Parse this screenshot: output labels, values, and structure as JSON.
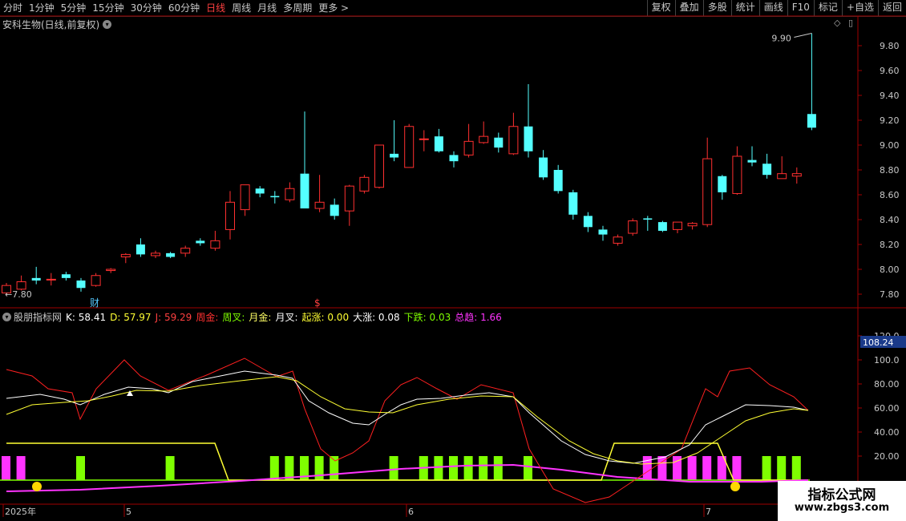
{
  "toolbar": {
    "periods": [
      "分时",
      "1分钟",
      "5分钟",
      "15分钟",
      "30分钟",
      "60分钟",
      "日线",
      "周线",
      "月线",
      "多周期",
      "更多 >"
    ],
    "active_period": "日线",
    "right_buttons": [
      "复权",
      "叠加",
      "多股",
      "统计",
      "画线",
      "F10",
      "标记",
      "+自选",
      "返回"
    ]
  },
  "main_chart": {
    "title": "安科生物(日线,前复权)",
    "price_axis": [
      "9.80",
      "9.60",
      "9.40",
      "9.20",
      "9.00",
      "8.80",
      "8.60",
      "8.40",
      "8.20",
      "8.00",
      "7.80"
    ],
    "high_label": "9.90",
    "low_label": "7.80",
    "markers": {
      "cai": "财",
      "dollar": "$"
    }
  },
  "indicator": {
    "name": "股朋指标网",
    "K": "K: 58.41",
    "D": "D: 57.97",
    "J": "J: 59.29",
    "items": [
      "周金:",
      "周叉:",
      "月金:",
      "月叉:",
      "起涨: 0.00",
      "大涨: 0.08",
      "下跌: 0.03",
      "总趋: 1.66"
    ],
    "axis": [
      "120.0",
      "100.0",
      "80.00",
      "60.00",
      "40.00",
      "20.00"
    ],
    "current_value": "108.24"
  },
  "date_axis": [
    "2025年",
    "5",
    "6",
    "7"
  ],
  "colors": {
    "up": "#ff3030",
    "down": "#54ffff",
    "k": "#ffffff",
    "d": "#ffff33",
    "j": "#ff2020",
    "magenta": "#ff33ff",
    "green": "#7fff00"
  },
  "watermark": {
    "line1": "指标公式网",
    "line2": "www.zbgs3.com"
  },
  "chart_data": {
    "type": "candlestick",
    "series": [
      {
        "o": 7.81,
        "c": 7.87,
        "h": 7.89,
        "l": 7.79
      },
      {
        "o": 7.84,
        "c": 7.9,
        "h": 7.95,
        "l": 7.83
      },
      {
        "o": 7.93,
        "c": 7.91,
        "h": 8.02,
        "l": 7.88
      },
      {
        "o": 7.92,
        "c": 7.92,
        "h": 7.97,
        "l": 7.87
      },
      {
        "o": 7.96,
        "c": 7.93,
        "h": 7.98,
        "l": 7.91
      },
      {
        "o": 7.91,
        "c": 7.85,
        "h": 7.93,
        "l": 7.82
      },
      {
        "o": 7.87,
        "c": 7.95,
        "h": 7.97,
        "l": 7.86
      },
      {
        "o": 7.99,
        "c": 8.0,
        "h": 8.01,
        "l": 7.97
      },
      {
        "o": 8.1,
        "c": 8.12,
        "h": 8.13,
        "l": 8.05
      },
      {
        "o": 8.2,
        "c": 8.12,
        "h": 8.25,
        "l": 8.1
      },
      {
        "o": 8.11,
        "c": 8.13,
        "h": 8.15,
        "l": 8.09
      },
      {
        "o": 8.13,
        "c": 8.1,
        "h": 8.14,
        "l": 8.09
      },
      {
        "o": 8.13,
        "c": 8.17,
        "h": 8.19,
        "l": 8.1
      },
      {
        "o": 8.23,
        "c": 8.21,
        "h": 8.25,
        "l": 8.19
      },
      {
        "o": 8.17,
        "c": 8.23,
        "h": 8.31,
        "l": 8.15
      },
      {
        "o": 8.32,
        "c": 8.54,
        "h": 8.63,
        "l": 8.24
      },
      {
        "o": 8.48,
        "c": 8.68,
        "h": 8.68,
        "l": 8.43
      },
      {
        "o": 8.65,
        "c": 8.61,
        "h": 8.67,
        "l": 8.58
      },
      {
        "o": 8.59,
        "c": 8.58,
        "h": 8.63,
        "l": 8.53
      },
      {
        "o": 8.56,
        "c": 8.65,
        "h": 8.7,
        "l": 8.54
      },
      {
        "o": 8.77,
        "c": 8.49,
        "h": 9.27,
        "l": 8.49
      },
      {
        "o": 8.49,
        "c": 8.54,
        "h": 8.76,
        "l": 8.46
      },
      {
        "o": 8.52,
        "c": 8.43,
        "h": 8.57,
        "l": 8.4
      },
      {
        "o": 8.47,
        "c": 8.67,
        "h": 8.68,
        "l": 8.35
      },
      {
        "o": 8.63,
        "c": 8.74,
        "h": 8.76,
        "l": 8.61
      },
      {
        "o": 8.66,
        "c": 9.0,
        "h": 9.0,
        "l": 8.65
      },
      {
        "o": 8.93,
        "c": 8.9,
        "h": 9.2,
        "l": 8.87
      },
      {
        "o": 8.82,
        "c": 9.15,
        "h": 9.17,
        "l": 8.82
      },
      {
        "o": 9.05,
        "c": 9.05,
        "h": 9.12,
        "l": 8.95
      },
      {
        "o": 9.07,
        "c": 8.95,
        "h": 9.13,
        "l": 8.94
      },
      {
        "o": 8.92,
        "c": 8.87,
        "h": 8.95,
        "l": 8.82
      },
      {
        "o": 8.92,
        "c": 9.03,
        "h": 9.17,
        "l": 8.9
      },
      {
        "o": 9.02,
        "c": 9.07,
        "h": 9.19,
        "l": 9.01
      },
      {
        "o": 9.06,
        "c": 8.98,
        "h": 9.1,
        "l": 8.94
      },
      {
        "o": 8.93,
        "c": 9.15,
        "h": 9.26,
        "l": 8.92
      },
      {
        "o": 9.15,
        "c": 8.95,
        "h": 9.49,
        "l": 8.9
      },
      {
        "o": 8.9,
        "c": 8.74,
        "h": 8.96,
        "l": 8.72
      },
      {
        "o": 8.8,
        "c": 8.63,
        "h": 8.84,
        "l": 8.61
      },
      {
        "o": 8.62,
        "c": 8.44,
        "h": 8.64,
        "l": 8.4
      },
      {
        "o": 8.43,
        "c": 8.34,
        "h": 8.46,
        "l": 8.3
      },
      {
        "o": 8.32,
        "c": 8.28,
        "h": 8.35,
        "l": 8.23
      },
      {
        "o": 8.21,
        "c": 8.26,
        "h": 8.28,
        "l": 8.19
      },
      {
        "o": 8.29,
        "c": 8.39,
        "h": 8.41,
        "l": 8.27
      },
      {
        "o": 8.41,
        "c": 8.4,
        "h": 8.43,
        "l": 8.31
      },
      {
        "o": 8.38,
        "c": 8.31,
        "h": 8.39,
        "l": 8.3
      },
      {
        "o": 8.32,
        "c": 8.38,
        "h": 8.38,
        "l": 8.29
      },
      {
        "o": 8.35,
        "c": 8.37,
        "h": 8.38,
        "l": 8.32
      },
      {
        "o": 8.36,
        "c": 8.89,
        "h": 9.06,
        "l": 8.34
      },
      {
        "o": 8.75,
        "c": 8.62,
        "h": 8.76,
        "l": 8.56
      },
      {
        "o": 8.61,
        "c": 8.91,
        "h": 8.99,
        "l": 8.6
      },
      {
        "o": 8.88,
        "c": 8.86,
        "h": 8.99,
        "l": 8.83
      },
      {
        "o": 8.85,
        "c": 8.76,
        "h": 8.93,
        "l": 8.73
      },
      {
        "o": 8.73,
        "c": 8.77,
        "h": 8.91,
        "l": 8.73
      },
      {
        "o": 8.75,
        "c": 8.77,
        "h": 8.82,
        "l": 8.69
      },
      {
        "o": 9.25,
        "c": 9.14,
        "h": 9.9,
        "l": 9.12
      }
    ]
  }
}
